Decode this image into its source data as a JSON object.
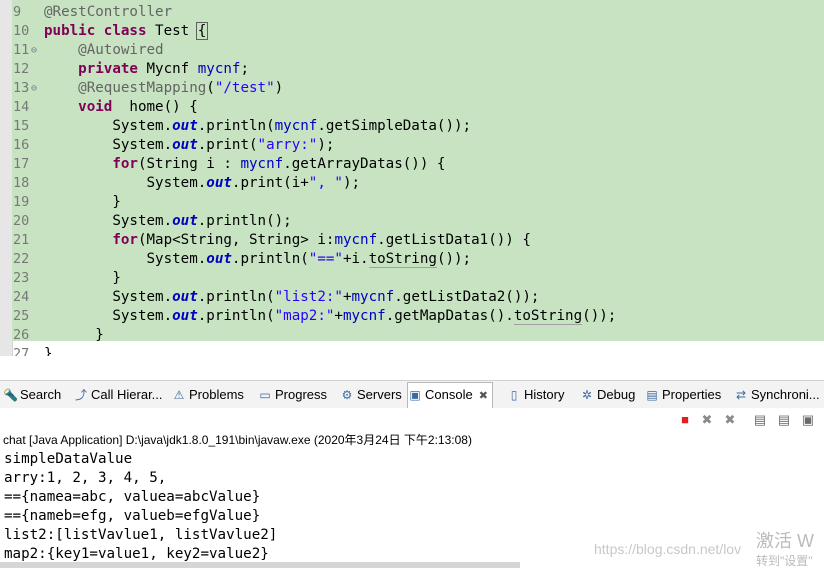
{
  "editor": {
    "lines": [
      {
        "n": "9",
        "segs": [
          {
            "t": "@RestController",
            "c": "an"
          }
        ]
      },
      {
        "n": "10",
        "segs": [
          {
            "t": "public",
            "c": "kw"
          },
          {
            "t": " "
          },
          {
            "t": "class",
            "c": "kw"
          },
          {
            "t": " Test "
          },
          {
            "t": "{",
            "c": "bracket-box"
          }
        ]
      },
      {
        "n": "11",
        "fold": "⊖",
        "segs": [
          {
            "t": "    "
          },
          {
            "t": "@Autowired",
            "c": "an"
          }
        ]
      },
      {
        "n": "12",
        "segs": [
          {
            "t": "    "
          },
          {
            "t": "private",
            "c": "kw"
          },
          {
            "t": " Mycnf "
          },
          {
            "t": "mycnf",
            "c": "fld"
          },
          {
            "t": ";"
          }
        ]
      },
      {
        "n": "13",
        "fold": "⊖",
        "segs": [
          {
            "t": "    "
          },
          {
            "t": "@RequestMapping",
            "c": "an"
          },
          {
            "t": "("
          },
          {
            "t": "\"/test\"",
            "c": "st"
          },
          {
            "t": ")"
          }
        ]
      },
      {
        "n": "14",
        "segs": [
          {
            "t": "    "
          },
          {
            "t": "void",
            "c": "kw"
          },
          {
            "t": "  home() {"
          }
        ]
      },
      {
        "n": "15",
        "segs": [
          {
            "t": "        System."
          },
          {
            "t": "out",
            "c": "sfld"
          },
          {
            "t": ".println("
          },
          {
            "t": "mycnf",
            "c": "fld"
          },
          {
            "t": ".getSimpleData());"
          }
        ]
      },
      {
        "n": "16",
        "segs": [
          {
            "t": "        System."
          },
          {
            "t": "out",
            "c": "sfld"
          },
          {
            "t": ".print("
          },
          {
            "t": "\"arry:\"",
            "c": "st"
          },
          {
            "t": ");"
          }
        ]
      },
      {
        "n": "17",
        "segs": [
          {
            "t": "        "
          },
          {
            "t": "for",
            "c": "kw"
          },
          {
            "t": "(String i : "
          },
          {
            "t": "mycnf",
            "c": "fld"
          },
          {
            "t": ".getArrayDatas()) {"
          }
        ]
      },
      {
        "n": "18",
        "segs": [
          {
            "t": "            System."
          },
          {
            "t": "out",
            "c": "sfld"
          },
          {
            "t": ".print(i+"
          },
          {
            "t": "\", \"",
            "c": "st"
          },
          {
            "t": ");"
          }
        ]
      },
      {
        "n": "19",
        "segs": [
          {
            "t": "        }"
          }
        ]
      },
      {
        "n": "20",
        "segs": [
          {
            "t": "        System."
          },
          {
            "t": "out",
            "c": "sfld"
          },
          {
            "t": ".println();"
          }
        ]
      },
      {
        "n": "21",
        "segs": [
          {
            "t": "        "
          },
          {
            "t": "for",
            "c": "kw"
          },
          {
            "t": "(Map<String, String> i:"
          },
          {
            "t": "mycnf",
            "c": "fld"
          },
          {
            "t": ".getListData1()) {"
          }
        ]
      },
      {
        "n": "22",
        "segs": [
          {
            "t": "            System."
          },
          {
            "t": "out",
            "c": "sfld"
          },
          {
            "t": ".println("
          },
          {
            "t": "\"==\"",
            "c": "st"
          },
          {
            "t": "+i."
          },
          {
            "t": "toString",
            "c": "underline"
          },
          {
            "t": "());"
          }
        ]
      },
      {
        "n": "23",
        "segs": [
          {
            "t": "        }"
          }
        ]
      },
      {
        "n": "24",
        "segs": [
          {
            "t": "        System."
          },
          {
            "t": "out",
            "c": "sfld"
          },
          {
            "t": ".println("
          },
          {
            "t": "\"list2:\"",
            "c": "st"
          },
          {
            "t": "+"
          },
          {
            "t": "mycnf",
            "c": "fld"
          },
          {
            "t": ".getListData2());"
          }
        ]
      },
      {
        "n": "25",
        "segs": [
          {
            "t": "        System."
          },
          {
            "t": "out",
            "c": "sfld"
          },
          {
            "t": ".println("
          },
          {
            "t": "\"map2:\"",
            "c": "st"
          },
          {
            "t": "+"
          },
          {
            "t": "mycnf",
            "c": "fld"
          },
          {
            "t": ".getMapDatas()."
          },
          {
            "t": "toString",
            "c": "underline"
          },
          {
            "t": "());"
          }
        ]
      },
      {
        "n": "26",
        "segs": [
          {
            "t": "      }"
          }
        ]
      },
      {
        "n": "27",
        "segs": [
          {
            "t": "}"
          }
        ]
      }
    ]
  },
  "tabs": [
    {
      "label": "Search",
      "icon": "search-icon",
      "glyph": "🔦"
    },
    {
      "label": "Call Hierar...",
      "icon": "call-hierarchy-icon",
      "glyph": "⤴"
    },
    {
      "label": "Problems",
      "icon": "problems-icon",
      "glyph": "⚠"
    },
    {
      "label": "Progress",
      "icon": "progress-icon",
      "glyph": "▭"
    },
    {
      "label": "Servers",
      "icon": "servers-icon",
      "glyph": "⚙"
    },
    {
      "label": "Console",
      "icon": "console-icon",
      "glyph": "▣",
      "active": true,
      "close": "✖"
    },
    {
      "label": "History",
      "icon": "history-icon",
      "glyph": "▯"
    },
    {
      "label": "Debug",
      "icon": "debug-icon",
      "glyph": "✲"
    },
    {
      "label": "Properties",
      "icon": "properties-icon",
      "glyph": "▤"
    },
    {
      "label": "Synchroni...",
      "icon": "synchronize-icon",
      "glyph": "⇄"
    }
  ],
  "console": {
    "title": "chat [Java Application] D:\\java\\jdk1.8.0_191\\bin\\javaw.exe (2020年3月24日 下午2:13:08)",
    "toolbar": [
      {
        "name": "terminate-icon",
        "glyph": "■",
        "color": "#e02020"
      },
      {
        "name": "remove-launch-icon",
        "glyph": "✖",
        "color": "#8a8a8a"
      },
      {
        "name": "remove-all-icon",
        "glyph": "✖",
        "color": "#8a8a8a"
      },
      {
        "name": "scroll-lock-icon",
        "glyph": "▤",
        "color": "#6a6a6a"
      },
      {
        "name": "pin-console-icon",
        "glyph": "▤",
        "color": "#6a6a6a"
      },
      {
        "name": "word-wrap-icon",
        "glyph": "▣",
        "color": "#6a6a6a"
      }
    ],
    "output": [
      "simpleDataValue",
      "arry:1, 2, 3, 4, 5,",
      "=={namea=abc, valuea=abcValue}",
      "=={nameb=efg, valueb=efgValue}",
      "list2:[listVavlue1, listVavlue2]",
      "map2:{key1=value1, key2=value2}"
    ]
  },
  "overlay": {
    "watermark": "https://blog.csdn.net/lov",
    "activate": "激活 W",
    "activate_sub": "转到\"设置\""
  }
}
